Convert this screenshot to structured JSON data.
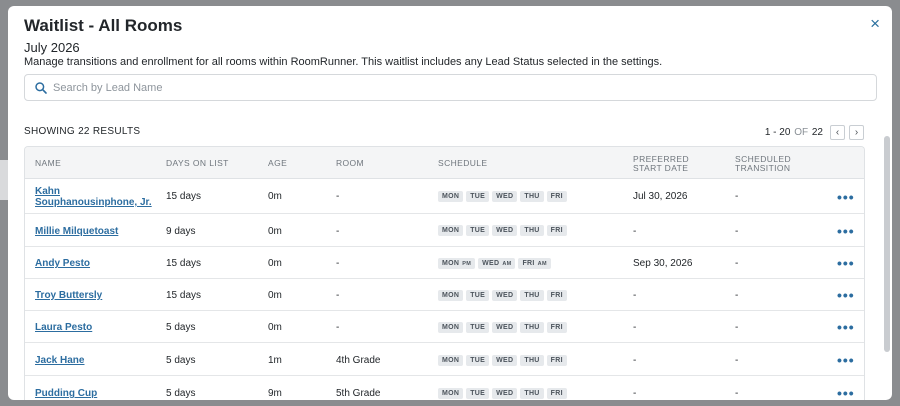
{
  "modal": {
    "title": "Waitlist - All Rooms",
    "close_icon": "×",
    "month": "July 2026",
    "description": "Manage transitions and enrollment for all rooms within RoomRunner. This waitlist includes any Lead Status selected in the settings."
  },
  "search": {
    "placeholder": "Search by Lead Name",
    "value": ""
  },
  "results": {
    "showing": "SHOWING 22 RESULTS",
    "range": "1 - 20",
    "of": "OF",
    "total": "22",
    "prev": "‹",
    "next": "›"
  },
  "table": {
    "headers": {
      "name": "NAME",
      "days": "DAYS ON LIST",
      "age": "AGE",
      "room": "ROOM",
      "schedule": "SCHEDULE",
      "start_1": "PREFERRED",
      "start_2": "START DATE",
      "trans_1": "SCHEDULED",
      "trans_2": "TRANSITION"
    },
    "rows": [
      {
        "name_1": "Kahn",
        "name_2": "Souphanousinphone, Jr.",
        "days": "15 days",
        "age": "0m",
        "room": "-",
        "start": "Jul 30, 2026",
        "transition": "-",
        "more": "•••"
      },
      {
        "name_1": "Millie Milquetoast",
        "days": "9 days",
        "age": "0m",
        "room": "-",
        "start": "-",
        "transition": "-",
        "more": "•••"
      },
      {
        "name_1": "Andy Pesto",
        "days": "15 days",
        "age": "0m",
        "room": "-",
        "start": "Sep 30, 2026",
        "transition": "-",
        "more": "•••"
      },
      {
        "name_1": "Troy Buttersly",
        "days": "15 days",
        "age": "0m",
        "room": "-",
        "start": "-",
        "transition": "-",
        "more": "•••"
      },
      {
        "name_1": "Laura Pesto",
        "days": "5 days",
        "age": "0m",
        "room": "-",
        "start": "-",
        "transition": "-",
        "more": "•••"
      },
      {
        "name_1": "Jack Hane",
        "days": "5 days",
        "age": "1m",
        "room": "4th Grade",
        "start": "-",
        "transition": "-",
        "more": "•••"
      },
      {
        "name_1": "Pudding Cup",
        "days": "5 days",
        "age": "9m",
        "room": "5th Grade",
        "start": "-",
        "transition": "-",
        "more": "•••"
      }
    ],
    "days": {
      "mon": "MON",
      "tue": "TUE",
      "wed": "WED",
      "thu": "THU",
      "fri": "FRI",
      "pm": "PM",
      "am": "AM"
    }
  },
  "colors": {
    "link": "#2c6da0",
    "backdrop": "#8a8c8f",
    "header_bg": "#f4f5f6"
  }
}
